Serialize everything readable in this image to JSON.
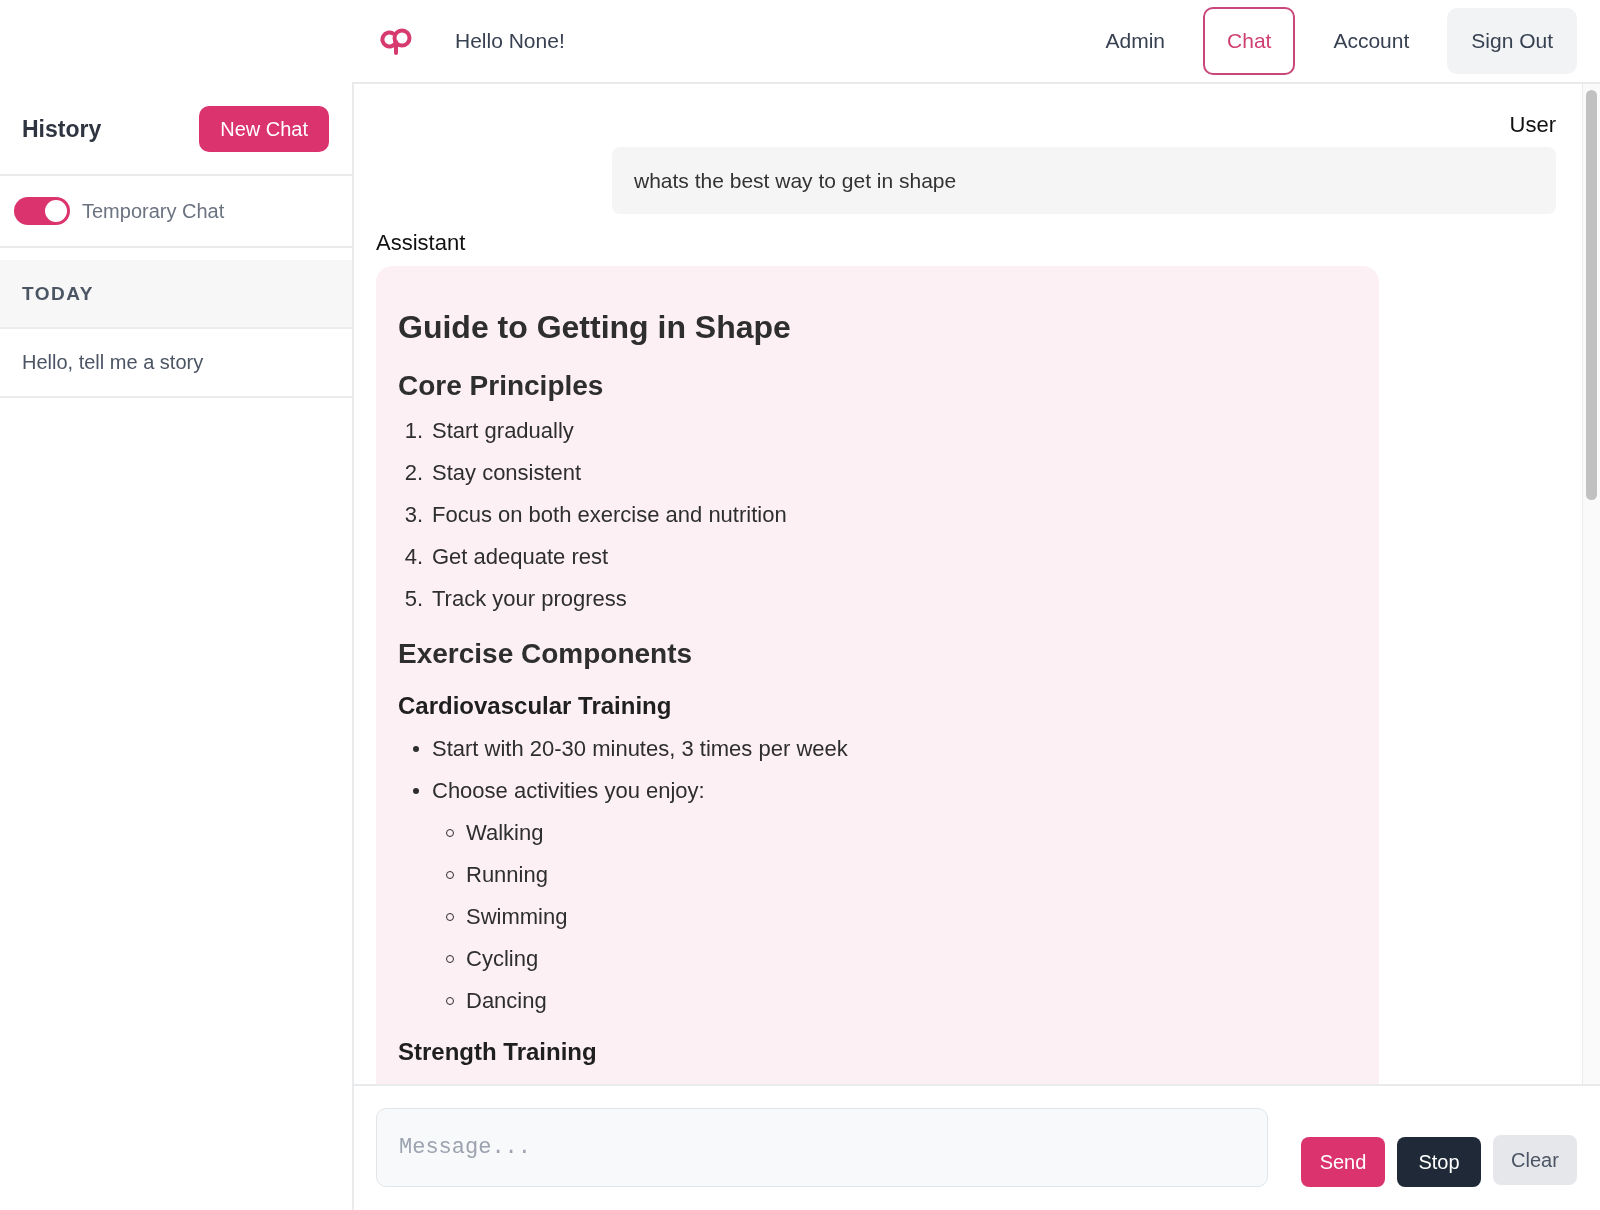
{
  "sidebar": {
    "title": "History",
    "new_chat_button": "New Chat",
    "temporary_chat": {
      "label": "Temporary Chat",
      "on": true
    },
    "history_groups": [
      {
        "heading": "TODAY",
        "items": [
          {
            "title": "Hello, tell me a story",
            "selected": false
          }
        ]
      }
    ]
  },
  "header": {
    "greeting": "Hello None!",
    "nav": [
      {
        "label": "Admin",
        "kind": "link",
        "selected": false
      },
      {
        "label": "Chat",
        "kind": "link",
        "selected": true
      },
      {
        "label": "Account",
        "kind": "link",
        "selected": false
      },
      {
        "label": "Sign Out",
        "kind": "button",
        "selected": false
      }
    ]
  },
  "conversation": {
    "messages": [
      {
        "kind": "user",
        "role": "User",
        "text": "whats the best way to get in shape"
      },
      {
        "kind": "assistant",
        "role": "Assistant",
        "blocks": [
          {
            "kind": "h1",
            "text": "Guide to Getting in Shape"
          },
          {
            "kind": "h2",
            "text": "Core Principles"
          },
          {
            "kind": "numbered_list",
            "items": [
              {
                "number": "1.",
                "text": "Start gradually"
              },
              {
                "number": "2.",
                "text": "Stay consistent"
              },
              {
                "number": "3.",
                "text": "Focus on both exercise and nutrition"
              },
              {
                "number": "4.",
                "text": "Get adequate rest"
              },
              {
                "number": "5.",
                "text": "Track your progress"
              }
            ]
          },
          {
            "kind": "h2",
            "text": "Exercise Components"
          },
          {
            "kind": "h3",
            "text": "Cardiovascular Training"
          },
          {
            "kind": "bullet_list",
            "items": [
              {
                "text": "Start with 20-30 minutes, 3 times per week"
              },
              {
                "text": "Choose activities you enjoy:",
                "children": [
                  {
                    "text": "Walking"
                  },
                  {
                    "text": "Running"
                  },
                  {
                    "text": "Swimming"
                  },
                  {
                    "text": "Cycling"
                  },
                  {
                    "text": "Dancing"
                  }
                ]
              }
            ]
          },
          {
            "kind": "h3",
            "text": "Strength Training"
          }
        ]
      }
    ]
  },
  "composer": {
    "placeholder": "Message...",
    "buttons": [
      {
        "label": "Send",
        "kind": "primary"
      },
      {
        "label": "Stop",
        "kind": "dark"
      },
      {
        "label": "Clear",
        "kind": "secondary"
      }
    ]
  }
}
